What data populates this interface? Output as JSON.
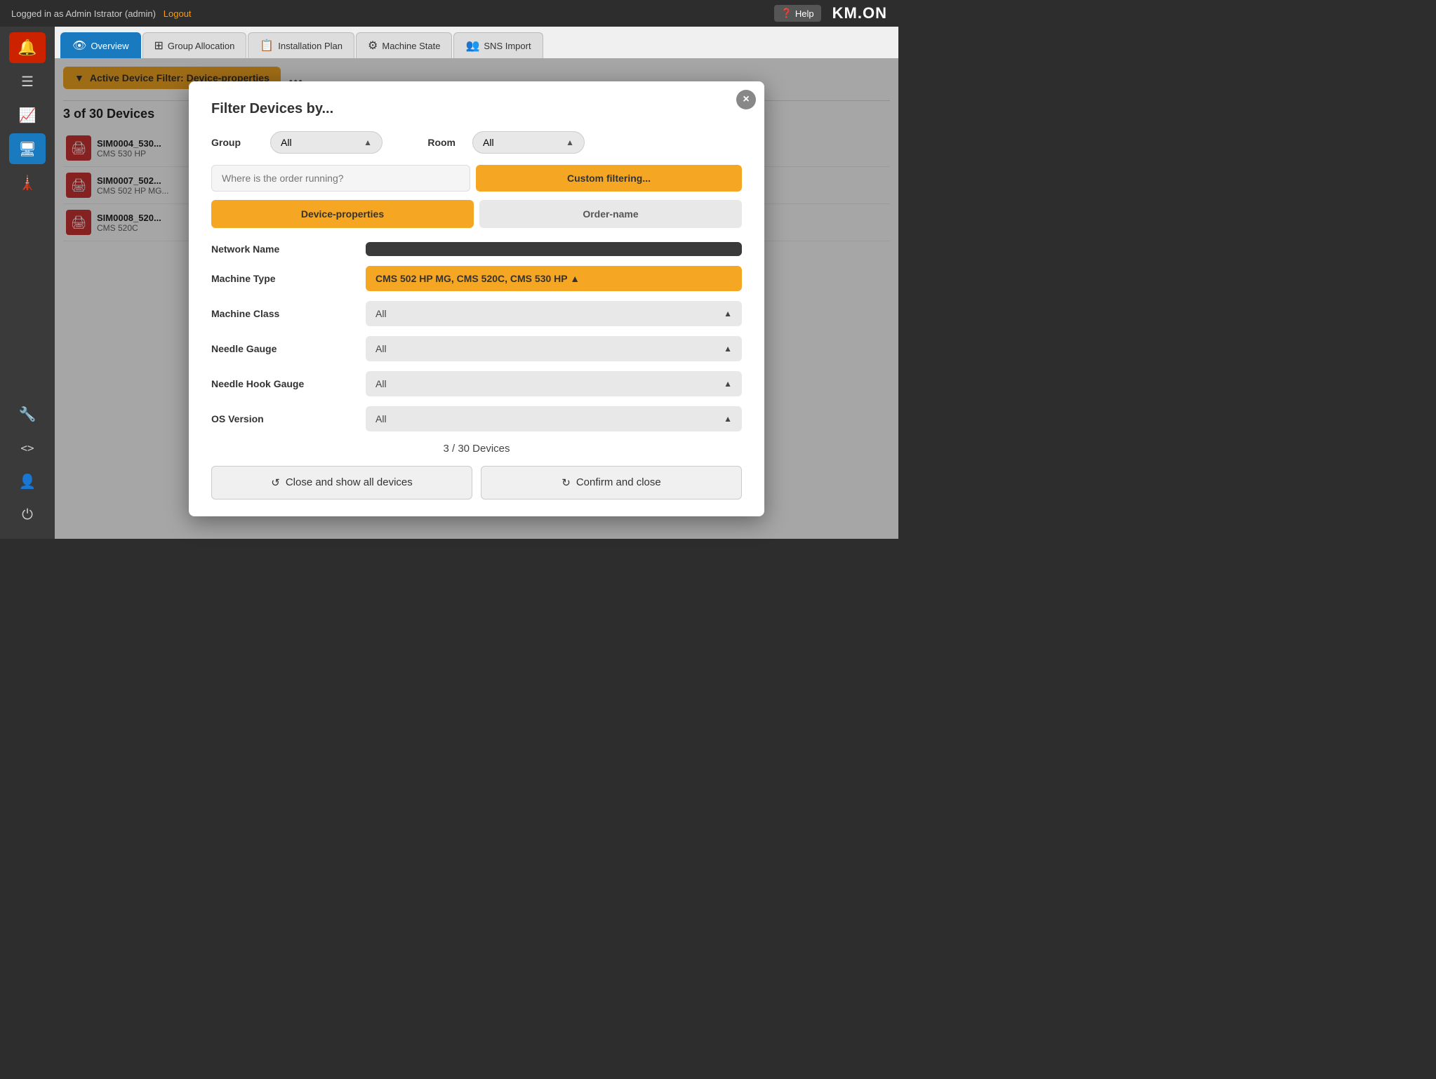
{
  "topbar": {
    "logged_in_as": "Logged in as Admin Istrator (admin)",
    "logout_label": "Logout",
    "help_label": "Help",
    "logo": "KM.ON"
  },
  "sidebar": {
    "icons": [
      {
        "name": "alert-icon",
        "symbol": "🔔",
        "active": false,
        "alert": true
      },
      {
        "name": "list-icon",
        "symbol": "≡",
        "active": false
      },
      {
        "name": "chart-icon",
        "symbol": "📊",
        "active": false
      },
      {
        "name": "monitor-icon",
        "symbol": "🖥",
        "active": true
      },
      {
        "name": "tower-icon",
        "symbol": "⚙",
        "active": false
      },
      {
        "name": "tools-icon",
        "symbol": "🔧",
        "active": false
      },
      {
        "name": "code-icon",
        "symbol": "<>",
        "active": false
      }
    ],
    "bottom_icons": [
      {
        "name": "user-icon",
        "symbol": "👤"
      },
      {
        "name": "power-icon",
        "symbol": "⏻"
      }
    ]
  },
  "nav": {
    "tabs": [
      {
        "id": "overview",
        "label": "Overview",
        "icon": "👁",
        "active": true
      },
      {
        "id": "group-allocation",
        "label": "Group Allocation",
        "icon": "⊞",
        "active": false
      },
      {
        "id": "installation-plan",
        "label": "Installation Plan",
        "icon": "📋",
        "active": false
      },
      {
        "id": "machine-state",
        "label": "Machine State",
        "icon": "⚙",
        "active": false
      },
      {
        "id": "sns-import",
        "label": "SNS Import",
        "icon": "👥",
        "active": false
      }
    ]
  },
  "filter_bar": {
    "filter_label": "Active Device Filter: Device-properties",
    "dots": "•••"
  },
  "device_list": {
    "count_text": "3 of 30 Devices",
    "devices": [
      {
        "name": "SIM0004_530...",
        "type": "CMS 530 HP"
      },
      {
        "name": "SIM0007_502...",
        "type": "CMS 502 HP MG..."
      },
      {
        "name": "SIM0008_520...",
        "type": "CMS 520C"
      }
    ]
  },
  "modal": {
    "title": "Filter Devices by...",
    "close_label": "×",
    "group_label": "Group",
    "group_value": "All",
    "room_label": "Room",
    "room_value": "All",
    "search_placeholder": "Where is the order running?",
    "custom_filter_label": "Custom filtering...",
    "filter_tabs": [
      {
        "id": "device-properties",
        "label": "Device-properties",
        "active": true
      },
      {
        "id": "order-name",
        "label": "Order-name",
        "active": false
      }
    ],
    "properties": [
      {
        "label": "Network Name",
        "value": "",
        "style": "dark"
      },
      {
        "label": "Machine Type",
        "value": "CMS 502 HP MG, CMS 520C, CMS 530 HP ▲",
        "style": "highlight"
      },
      {
        "label": "Machine Class",
        "value": "All",
        "style": "normal"
      },
      {
        "label": "Needle Gauge",
        "value": "All",
        "style": "normal"
      },
      {
        "label": "Needle Hook Gauge",
        "value": "All",
        "style": "normal"
      },
      {
        "label": "OS Version",
        "value": "All",
        "style": "normal"
      }
    ],
    "result_count": "3 / 30 Devices",
    "close_all_label": "Close and show all devices",
    "confirm_label": "Confirm and close"
  }
}
